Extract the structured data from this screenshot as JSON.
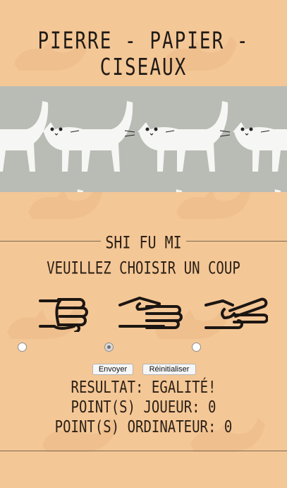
{
  "header": {
    "title": "PIERRE - PAPIER - CISEAUX"
  },
  "section": {
    "label": "SHI FU MI"
  },
  "game": {
    "prompt": "VEUILLEZ CHOISIR UN COUP",
    "choices": [
      {
        "icon": "rock-hand-icon",
        "selected": false
      },
      {
        "icon": "paper-hand-icon",
        "selected": true
      },
      {
        "icon": "scissors-hand-icon",
        "selected": false
      }
    ],
    "submit_label": "Envoyer",
    "reset_label": "Réinitialiser"
  },
  "results": {
    "result": "RESULTAT: EGALITÉ!",
    "player_points": "POINT(S) JOUEUR: 0",
    "computer_points": "POINT(S) ORDINATEUR: 0"
  },
  "colors": {
    "background": "#f4c796",
    "banner": "#b9bcb5",
    "text": "#2a1f16"
  }
}
